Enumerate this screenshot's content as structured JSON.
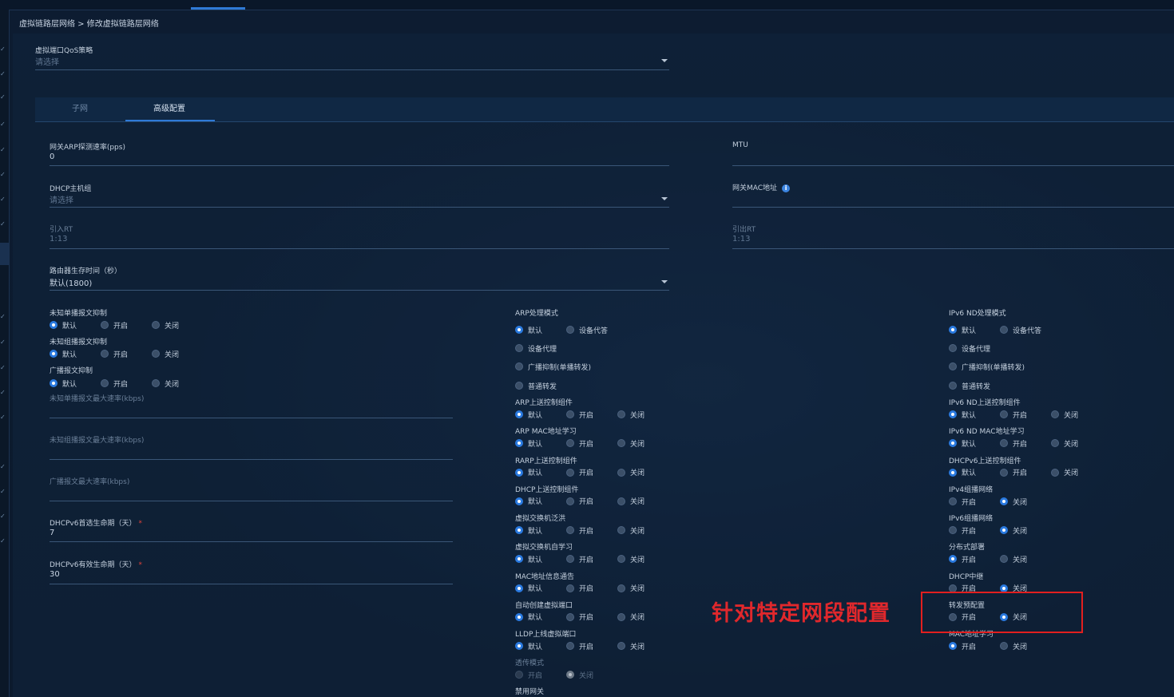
{
  "breadcrumb": "虚拟链路层网络 > 修改虚拟链路层网络",
  "qos": {
    "label": "虚拟端口QoS策略",
    "placeholder": "请选择"
  },
  "tabs": [
    {
      "label": "子网"
    },
    {
      "label": "高级配置"
    }
  ],
  "fields": {
    "arp_rate": {
      "label": "网关ARP探测速率(pps)",
      "value": "0"
    },
    "mtu": {
      "label": "MTU",
      "value": ""
    },
    "dhcp_group": {
      "label": "DHCP主机组",
      "placeholder": "请选择"
    },
    "gw_mac": {
      "label": "网关MAC地址",
      "value": ""
    },
    "import_rt": {
      "label": "引入RT",
      "value": "1:13"
    },
    "export_rt": {
      "label": "引出RT",
      "value": "1:13"
    },
    "router_lifetime": {
      "label": "路由器生存时间（秒）",
      "value": "默认(1800)"
    },
    "unknown_unicast_max": {
      "label": "未知单播报文最大速率(kbps)"
    },
    "unknown_multicast_max": {
      "label": "未知组播报文最大速率(kbps)"
    },
    "broadcast_max": {
      "label": "广播报文最大速率(kbps)"
    },
    "dhcpv6_preferred": {
      "label": "DHCPv6首选生命期（天）",
      "value": "7"
    },
    "dhcpv6_valid": {
      "label": "DHCPv6有效生命期（天）",
      "value": "30"
    }
  },
  "options": {
    "default": "默认",
    "on": "开启",
    "off": "关闭",
    "device_proxy": "设备代答",
    "device_proxy2": "设备代理",
    "broadcast_suppress": "广播抑制(单播转发)",
    "normal_forward": "普通转发"
  },
  "left_groups": [
    {
      "title": "未知单播报文抑制",
      "opts": [
        "默认",
        "开启",
        "关闭"
      ],
      "selected": 0
    },
    {
      "title": "未知组播报文抑制",
      "opts": [
        "默认",
        "开启",
        "关闭"
      ],
      "selected": 0
    },
    {
      "title": "广播报文抑制",
      "opts": [
        "默认",
        "开启",
        "关闭"
      ],
      "selected": 0
    }
  ],
  "mid": {
    "mode_title": "ARP处理模式",
    "groups": [
      {
        "title": "ARP上送控制组件",
        "selected": 0
      },
      {
        "title": "ARP MAC地址学习",
        "selected": 0
      },
      {
        "title": "RARP上送控制组件",
        "selected": 0
      },
      {
        "title": "DHCP上送控制组件",
        "selected": 0
      },
      {
        "title": "虚拟交换机泛洪",
        "selected": 0
      },
      {
        "title": "虚拟交换机自学习",
        "selected": 0
      },
      {
        "title": "MAC地址信息通告",
        "selected": 0
      },
      {
        "title": "自动创建虚拟端口",
        "selected": 0
      },
      {
        "title": "LLDP上线虚拟端口",
        "selected": 0
      }
    ],
    "transit_title": "透传模式",
    "disable_gw_title": "禁用网关"
  },
  "right": {
    "mode_title": "IPv6 ND处理模式",
    "groups3": [
      {
        "title": "IPv6 ND上送控制组件",
        "selected": 0
      },
      {
        "title": "IPv6 ND MAC地址学习",
        "selected": 0
      },
      {
        "title": "DHCPv6上送控制组件",
        "selected": 0
      }
    ],
    "groups2": [
      {
        "title": "IPv4组播网络",
        "selected": 1
      },
      {
        "title": "IPv6组播网络",
        "selected": 1
      },
      {
        "title": "分布式部署",
        "selected": 0
      },
      {
        "title": "DHCP中继",
        "selected": 1
      },
      {
        "title": "转发预配置",
        "selected": 1
      },
      {
        "title": "MAC地址学习",
        "selected": 0
      }
    ]
  },
  "annotation": {
    "text": "针对特定网段配置",
    "color": "#e0282c"
  }
}
